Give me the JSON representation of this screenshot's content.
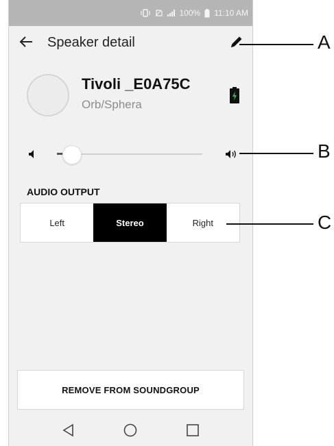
{
  "status_bar": {
    "battery_text": "100%",
    "time": "11:10 AM"
  },
  "header": {
    "title": "Speaker detail"
  },
  "speaker": {
    "name": "Tivoli _E0A75C",
    "model": "Orb/Sphera"
  },
  "volume": {
    "level": 0.1
  },
  "audio_output": {
    "label": "AUDIO OUTPUT",
    "options": [
      "Left",
      "Stereo",
      "Right"
    ],
    "selected": "Stereo"
  },
  "remove_button": {
    "label": "REMOVE FROM SOUNDGROUP"
  },
  "callouts": [
    "A",
    "B",
    "C"
  ],
  "colors": {
    "accent": "#000000",
    "battery": "#3ab54a",
    "status_bar": "#b5b5b5"
  }
}
